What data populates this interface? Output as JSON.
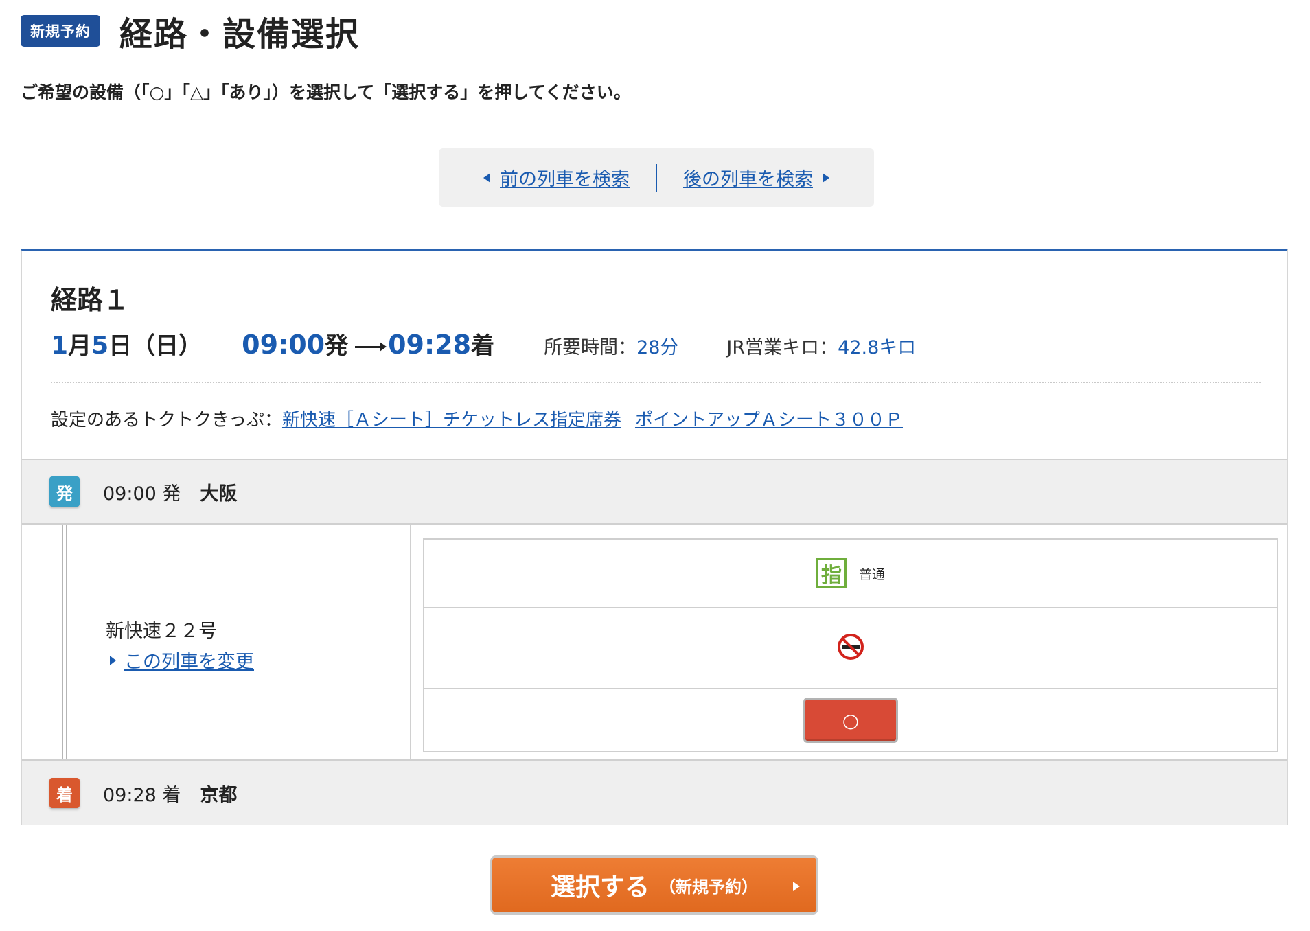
{
  "header": {
    "badge": "新規予約",
    "title": "経路・設備選択"
  },
  "instruction": "ご希望の設備（「○」「△」「あり」）を選択して「選択する」を押してください。",
  "search_nav": {
    "prev_label": "前の列車を検索",
    "next_label": "後の列車を検索"
  },
  "route": {
    "title": "経路１",
    "date": {
      "month": "1",
      "month_unit": "月",
      "day": "5",
      "day_unit": "日",
      "weekday": "（日）"
    },
    "depart_time": "09:00",
    "depart_suffix": "発",
    "arrive_time": "09:28",
    "arrive_suffix": "着",
    "duration_label": "所要時間：",
    "duration_value": "28分",
    "distance_label": "JR営業キロ：",
    "distance_value": "42.8キロ",
    "tickets_label": "設定のあるトクトクきっぷ：",
    "tickets": [
      "新快速［Ａシート］チケットレス指定席券",
      "ポイントアップＡシート３００Ｐ"
    ],
    "departure": {
      "badge": "発",
      "time": "09:00 発",
      "station": "大阪"
    },
    "arrival": {
      "badge": "着",
      "time": "09:28 着",
      "station": "京都"
    },
    "train": {
      "name": "新快速２２号",
      "change_label": "この列車を変更"
    },
    "seat": {
      "icon_char": "指",
      "type_label": "普通",
      "smoking_icon": "no-smoking-icon",
      "availability": "○"
    }
  },
  "submit": {
    "label": "選択する",
    "sub_label": "（新規予約）"
  },
  "colors": {
    "primary_blue": "#1a5bb0",
    "badge_blue": "#1f4f98",
    "depart_badge": "#3aa0c6",
    "arrive_badge": "#d9582e",
    "seat_button": "#d84a36",
    "submit_orange": "#e87326",
    "shitei_green": "#6fae3c"
  }
}
